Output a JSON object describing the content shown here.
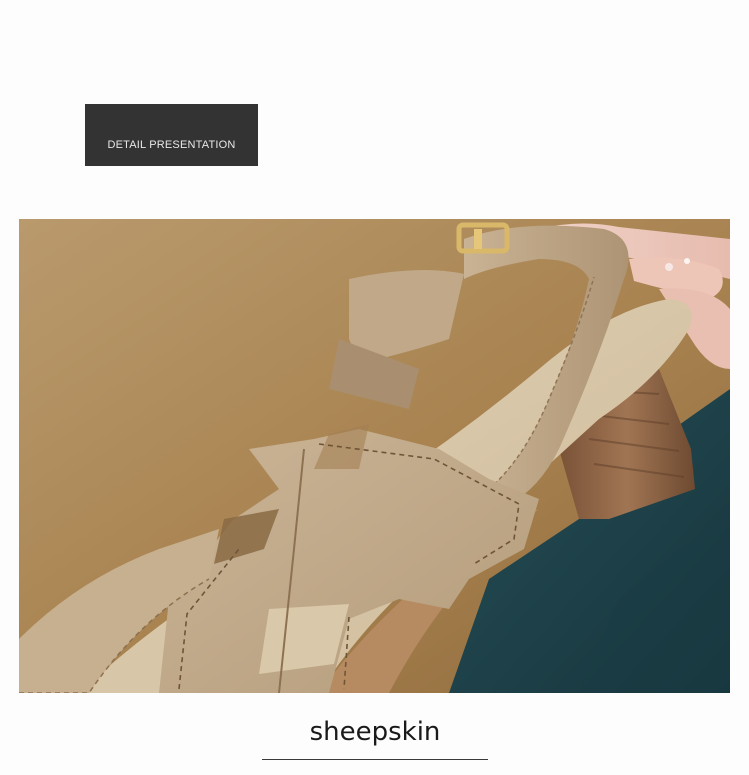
{
  "header": {
    "badge_label": "DETAIL PRESENTATION"
  },
  "photo": {
    "subject": "beige leather slingback sandal with H-shaped cut-out strap, block heel, on teal fabric",
    "colors": {
      "background_wall": "#b08c5e",
      "leather": "#c2ab8c",
      "fabric": "#1d3f47"
    }
  },
  "caption": {
    "text": "sheepskin"
  },
  "colors": {
    "page_background": "#fdfdfd",
    "badge_background": "#333333",
    "badge_text": "#e8e8e8",
    "caption_text": "#1a1a1a"
  }
}
